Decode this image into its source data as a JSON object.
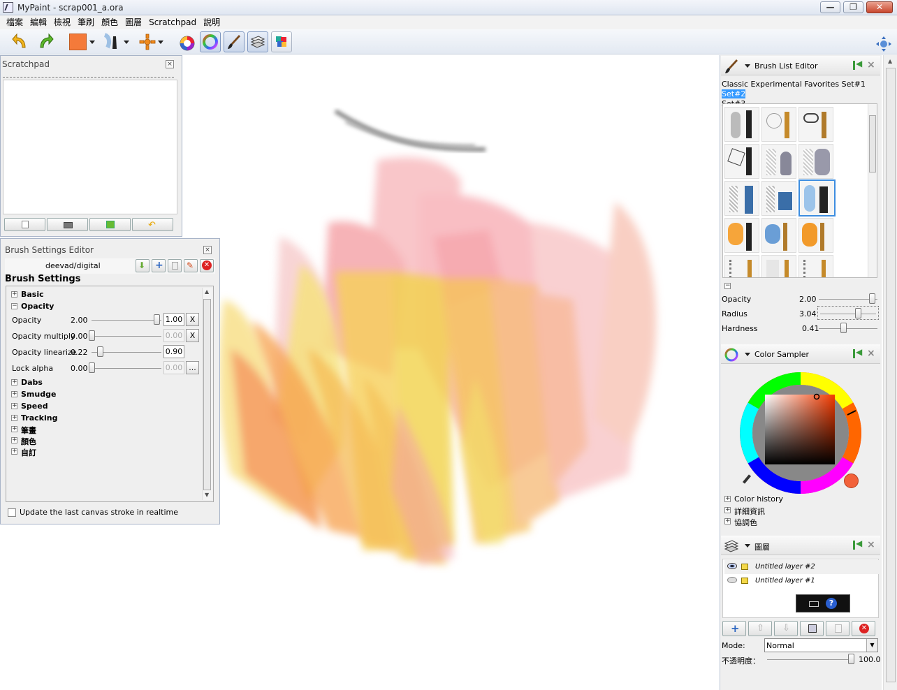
{
  "window": {
    "title": "MyPaint - scrap001_a.ora"
  },
  "menu": [
    "檔案",
    "編輯",
    "檢視",
    "筆刷",
    "顏色",
    "圖層",
    "Scratchpad",
    "說明"
  ],
  "toolbar": {
    "icons": [
      "undo-icon",
      "redo-icon",
      "color-swatch",
      "brush-selector-icon",
      "modes-icon",
      "color-circle-icon",
      "color-sampler-icon",
      "brush-editor-icon",
      "layers-icon",
      "color-palette-icon",
      "fullscreen-icon"
    ],
    "color_swatch": "#f47a3a"
  },
  "scratchpad": {
    "title": "Scratchpad"
  },
  "brush_settings": {
    "title": "Brush Settings Editor",
    "brush_name": "deevad/digital",
    "heading": "Brush Settings",
    "groups_top": [
      "Basic",
      "Opacity"
    ],
    "settings": [
      {
        "label": "Opacity",
        "value": "2.00",
        "box": "1.00",
        "button": "X",
        "box_disabled": false
      },
      {
        "label": "Opacity multiply",
        "value": "0.00",
        "box": "0.00",
        "button": "X",
        "box_disabled": true
      },
      {
        "label": "Opacity linearize",
        "value": "0.22",
        "box": "0.90",
        "button": "",
        "box_disabled": false
      },
      {
        "label": "Lock alpha",
        "value": "0.00",
        "box": "0.00",
        "button": "...",
        "box_disabled": true
      }
    ],
    "groups_bottom": [
      "Dabs",
      "Smudge",
      "Speed",
      "Tracking",
      "筆畫",
      "顏色",
      "自訂"
    ],
    "realtime_label": "Update the last canvas stroke in realtime"
  },
  "brush_list": {
    "title": "Brush List Editor",
    "groups": [
      "Classic",
      "Experimental",
      "Favorites",
      "Set#1",
      "Set#2",
      "Set#3"
    ],
    "selected_group": "Set#2",
    "opacity": {
      "label": "Opacity",
      "value": "2.00"
    },
    "radius": {
      "label": "Radius",
      "value": "3.04"
    },
    "hardness": {
      "label": "Hardness",
      "value": "0.41"
    }
  },
  "color_sampler": {
    "title": "Color Sampler",
    "current_color": "#f2623a",
    "sections": [
      "Color history",
      "詳細資訊",
      "協調色"
    ]
  },
  "layers": {
    "title": "圖層",
    "items": [
      "Untitled layer #2",
      "Untitled layer #1"
    ],
    "mode_label": "Mode:",
    "mode_value": "Normal",
    "opacity_label": "不透明度：",
    "opacity_value": "100.0"
  }
}
